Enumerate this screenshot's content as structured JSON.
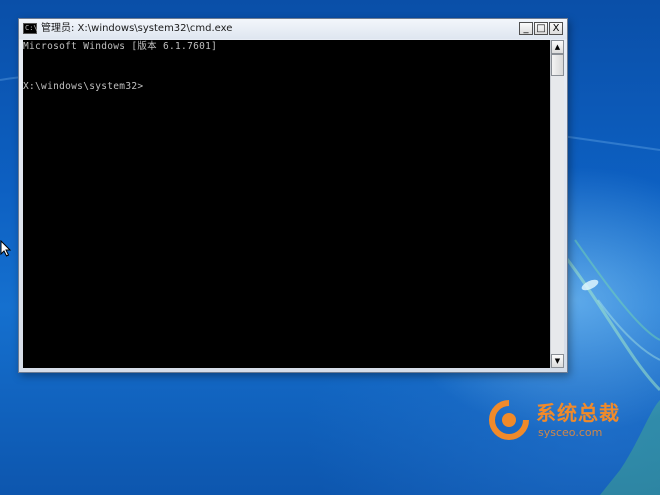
{
  "window": {
    "title": "管理员: X:\\windows\\system32\\cmd.exe",
    "icon_label": "C:\\",
    "minimize_glyph": "_",
    "maximize_glyph": "□",
    "close_glyph": "X"
  },
  "console": {
    "lines": [
      "Microsoft Windows [版本 6.1.7601]",
      "",
      "",
      "X:\\windows\\system32>"
    ]
  },
  "scrollbar": {
    "up_glyph": "▲",
    "down_glyph": "▼"
  },
  "watermark": {
    "brand": "系统总裁",
    "url": "sysceo.com"
  },
  "colors": {
    "desktop": "#0d60c2",
    "console_bg": "#000000",
    "console_fg": "#c0c0c0",
    "watermark": "#f08a2a"
  }
}
